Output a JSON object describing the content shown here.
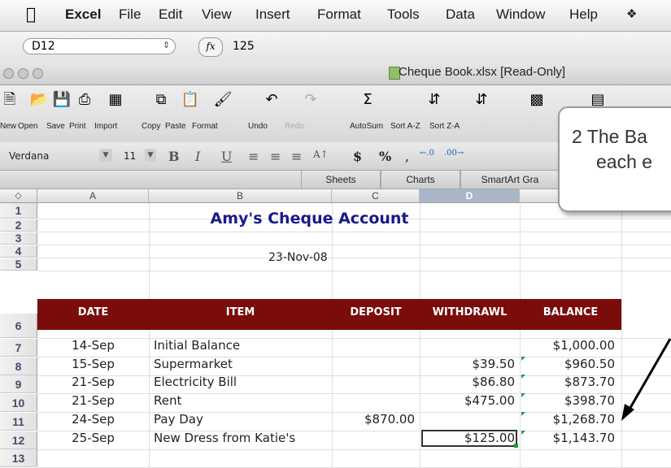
{
  "menubar": {
    "items": [
      "Excel",
      "File",
      "Edit",
      "View",
      "Insert",
      "Format",
      "Tools",
      "Data",
      "Window",
      "Help"
    ]
  },
  "formula_bar": {
    "cell_ref": "D12",
    "fx_label": "fx",
    "value": "125"
  },
  "window": {
    "title": "Cheque Book.xlsx  [Read-Only]"
  },
  "toolbar": {
    "buttons": [
      "New",
      "Open",
      "Save",
      "Print",
      "Import",
      "Copy",
      "Paste",
      "Format",
      "Undo",
      "Redo",
      "AutoSum",
      "Sort A-Z",
      "Sort Z-A"
    ]
  },
  "format_bar": {
    "font_name": "Verdana",
    "font_size": "11",
    "bold": "B",
    "italic": "I",
    "underline": "U",
    "currency": "$",
    "percent": "%"
  },
  "ribbon_tabs": [
    "Sheets",
    "Charts",
    "SmartArt Gra"
  ],
  "columns": [
    "A",
    "B",
    "C",
    "D"
  ],
  "rows": [
    "1",
    "2",
    "3",
    "4",
    "5",
    "6",
    "7",
    "8",
    "9",
    "10",
    "11",
    "12",
    "13"
  ],
  "sheet": {
    "title": "Amy's Cheque Account",
    "date": "23-Nov-08",
    "headers": [
      "DATE",
      "ITEM",
      "DEPOSIT",
      "WITHDRAWL",
      "BALANCE"
    ],
    "records": [
      {
        "date": "14-Sep",
        "item": "Initial Balance",
        "deposit": "",
        "withdrawal": "",
        "balance": "$1,000.00"
      },
      {
        "date": "15-Sep",
        "item": "Supermarket",
        "deposit": "",
        "withdrawal": "$39.50",
        "balance": "$960.50"
      },
      {
        "date": "21-Sep",
        "item": "Electricity Bill",
        "deposit": "",
        "withdrawal": "$86.80",
        "balance": "$873.70"
      },
      {
        "date": "21-Sep",
        "item": "Rent",
        "deposit": "",
        "withdrawal": "$475.00",
        "balance": "$398.70"
      },
      {
        "date": "24-Sep",
        "item": "Pay Day",
        "deposit": "$870.00",
        "withdrawal": "",
        "balance": "$1,268.70"
      },
      {
        "date": "25-Sep",
        "item": "New Dress from Katie's",
        "deposit": "",
        "withdrawal": "$125.00",
        "balance": "$1,143.70"
      }
    ]
  },
  "callout": {
    "line1": "2  The Ba",
    "line2": "each e"
  },
  "colors": {
    "header_band": "#7a0c0c",
    "title_text": "#1a1a8c",
    "arrow": "#000000"
  }
}
